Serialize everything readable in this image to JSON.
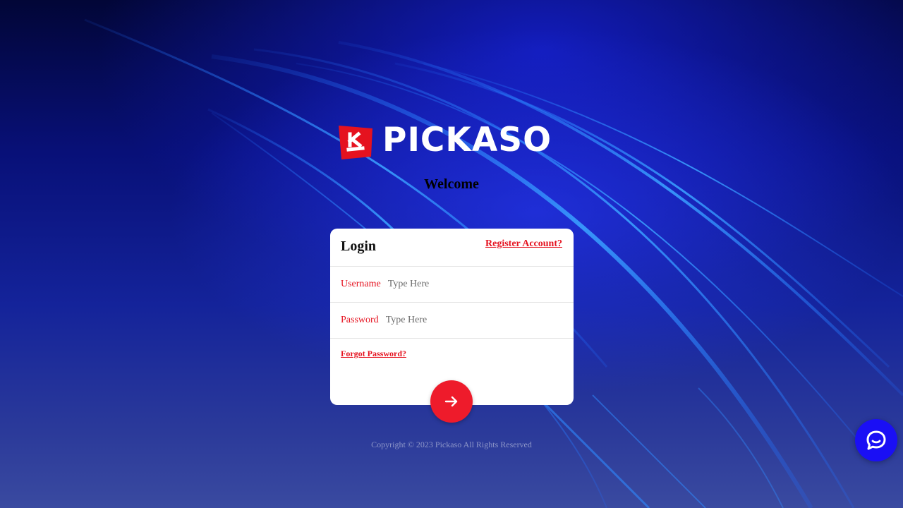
{
  "brand": {
    "name": "PICKASO",
    "mark_color": "#e5121f"
  },
  "welcome": "Welcome",
  "login_card": {
    "title": "Login",
    "register_link": "Register Account?",
    "fields": [
      {
        "label": "Username",
        "placeholder": "Type Here",
        "value": ""
      },
      {
        "label": "Password",
        "placeholder": "Type Here",
        "value": ""
      }
    ],
    "forgot_link": "Forgot Password?",
    "submit_icon": "arrow-right-icon"
  },
  "footer": {
    "copyright": "Copyright © 2023 Pickaso All Rights Reserved"
  },
  "chat_widget": {
    "icon": "chat-bubble-icon",
    "color": "#1a0ff5"
  },
  "colors": {
    "accent": "#e5121f",
    "button": "#ee1b2b",
    "background_dark": "#020637",
    "background_mid": "#14239a"
  }
}
